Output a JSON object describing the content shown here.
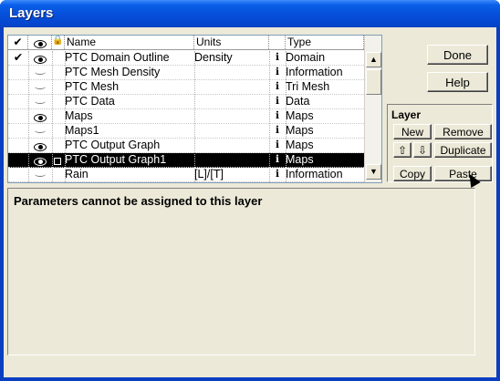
{
  "window": {
    "title": "Layers"
  },
  "columns": {
    "check": "✔",
    "visible_icon": "eye-icon",
    "lock_icon": "lock-icon",
    "name": "Name",
    "units": "Units",
    "type": "Type"
  },
  "rows": [
    {
      "checked": "✔",
      "visible": true,
      "locked": false,
      "name": "PTC Domain Outline",
      "units": "Density",
      "info": "ℹ",
      "type": "Domain",
      "selected": false
    },
    {
      "checked": "",
      "visible": false,
      "locked": false,
      "name": "PTC Mesh Density",
      "units": "",
      "info": "ℹ",
      "type": "Information",
      "selected": false
    },
    {
      "checked": "",
      "visible": false,
      "locked": false,
      "name": "PTC Mesh",
      "units": "",
      "info": "ℹ",
      "type": "Tri Mesh",
      "selected": false
    },
    {
      "checked": "",
      "visible": false,
      "locked": false,
      "name": "PTC Data",
      "units": "",
      "info": "ℹ",
      "type": "Data",
      "selected": false
    },
    {
      "checked": "",
      "visible": true,
      "locked": false,
      "name": "Maps",
      "units": "",
      "info": "ℹ",
      "type": "Maps",
      "selected": false
    },
    {
      "checked": "",
      "visible": false,
      "locked": false,
      "name": "Maps1",
      "units": "",
      "info": "ℹ",
      "type": "Maps",
      "selected": false
    },
    {
      "checked": "",
      "visible": true,
      "locked": false,
      "name": "PTC Output Graph",
      "units": "",
      "info": "ℹ",
      "type": "Maps",
      "selected": false
    },
    {
      "checked": "",
      "visible": true,
      "locked": true,
      "name": "PTC Output Graph1",
      "units": "",
      "info": "ℹ",
      "type": "Maps",
      "selected": true
    },
    {
      "checked": "",
      "visible": false,
      "locked": false,
      "name": "Rain",
      "units": "[L]/[T]",
      "info": "ℹ",
      "type": "Information",
      "selected": false
    }
  ],
  "buttons": {
    "done": "Done",
    "help": "Help",
    "new": "New",
    "remove": "Remove",
    "move_up": "⇧",
    "move_down": "⇩",
    "duplicate": "Duplicate",
    "copy": "Copy",
    "paste": "Paste"
  },
  "layer_panel": {
    "title": "Layer"
  },
  "message": "Parameters cannot be assigned to this layer",
  "colors": {
    "titlebar": "#0651db",
    "selection": "#000000",
    "face": "#ece9d8"
  }
}
